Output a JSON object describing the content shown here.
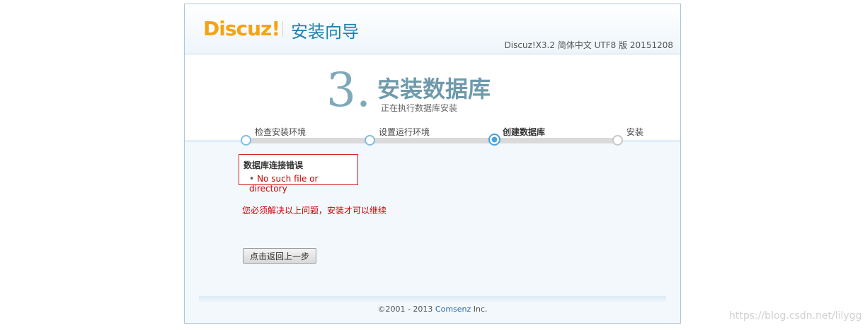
{
  "header": {
    "logo_text": "Discuz!",
    "wizard_title": "安装向导",
    "version": "Discuz!X3.2 简体中文 UTF8 版 20151208"
  },
  "step": {
    "number": "3.",
    "title": "安装数据库",
    "subtitle": "正在执行数据库安装"
  },
  "progress": {
    "steps": [
      {
        "label": "检查安装环境",
        "state": "done"
      },
      {
        "label": "设置运行环境",
        "state": "done"
      },
      {
        "label": "创建数据库",
        "state": "current"
      },
      {
        "label": "安装",
        "state": "pending"
      }
    ]
  },
  "error": {
    "title": "数据库连接错误",
    "items": [
      "No such file or directory"
    ]
  },
  "warning": "您必须解决以上问题，安装才可以继续",
  "back_button": "点击返回上一步",
  "footer": {
    "prefix": "©2001 - 2013 ",
    "link": "Comsenz",
    "suffix": " Inc."
  },
  "watermark": "https://blog.csdn.net/lilygg",
  "colors": {
    "logo": "#f6a313",
    "accent": "#1f7fae",
    "error": "#cc0000"
  }
}
